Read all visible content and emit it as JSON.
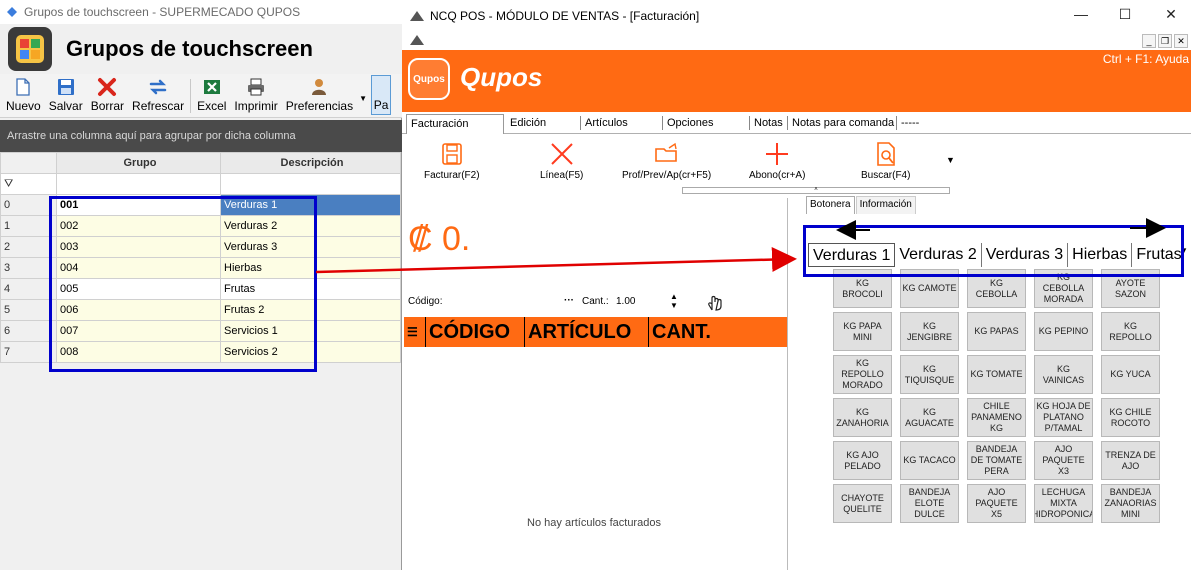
{
  "left_window": {
    "title": "Grupos de touchscreen - SUPERMECADO QUPOS",
    "header_title": "Grupos de touchscreen",
    "toolbar": [
      {
        "label": "Nuevo",
        "icon": "new-document-icon"
      },
      {
        "label": "Salvar",
        "icon": "save-icon"
      },
      {
        "label": "Borrar",
        "icon": "delete-x-icon"
      },
      {
        "label": "Refrescar",
        "icon": "refresh-icon"
      },
      {
        "label": "Excel",
        "icon": "excel-icon"
      },
      {
        "label": "Imprimir",
        "icon": "printer-icon"
      },
      {
        "label": "Preferencias",
        "icon": "user-preferences-icon"
      }
    ],
    "toolbar_cut_label": "Pa",
    "group_bar_text": "Arrastre una columna aquí para agrupar por dicha columna",
    "columns": [
      "Grupo",
      "Descripción"
    ],
    "rows": [
      {
        "index": "0",
        "grupo": "001",
        "descripcion": "Verduras 1"
      },
      {
        "index": "1",
        "grupo": "002",
        "descripcion": "Verduras 2"
      },
      {
        "index": "2",
        "grupo": "003",
        "descripcion": "Verduras 3"
      },
      {
        "index": "3",
        "grupo": "004",
        "descripcion": "Hierbas"
      },
      {
        "index": "4",
        "grupo": "005",
        "descripcion": "Frutas"
      },
      {
        "index": "5",
        "grupo": "006",
        "descripcion": "Frutas 2"
      },
      {
        "index": "6",
        "grupo": "007",
        "descripcion": "Servicios 1"
      },
      {
        "index": "7",
        "grupo": "008",
        "descripcion": "Servicios 2"
      }
    ]
  },
  "right_window": {
    "title": "NCQ POS - MÓDULO DE VENTAS - [Facturación]",
    "brand": "Qupos",
    "logo_text": "Qupos",
    "help_hint": "Ctrl + F1: Ayuda",
    "menu": [
      "Facturación",
      "Edición",
      "Artículos",
      "Opciones",
      "Notas",
      "Notas para comanda",
      "-----"
    ],
    "commands": [
      {
        "label": "Facturar(F2)",
        "icon": "save-icon"
      },
      {
        "label": "Línea(F5)",
        "icon": "delete-x-icon"
      },
      {
        "label": "Prof/Prev/Ap(cr+F5)",
        "icon": "folder-open-icon"
      },
      {
        "label": "Abono(cr+A)",
        "icon": "plus-icon"
      },
      {
        "label": "Buscar(F4)",
        "icon": "search-document-icon"
      }
    ],
    "total": "₡ 0.",
    "codigo_label": "Código:",
    "codigo_dots": "···",
    "cant_label": "Cant.:",
    "cant_value": "1.00",
    "items_columns": [
      "CÓDIGO",
      "ARTÍCULO",
      "CANT."
    ],
    "empty_message": "No hay artículos facturados",
    "side_tabs": [
      "Botonera",
      "Información"
    ],
    "category_tabs": [
      "Verduras 1",
      "Verduras 2",
      "Verduras 3",
      "Hierbas",
      "Frutas"
    ],
    "products": [
      "KG BROCOLI",
      "KG CAMOTE",
      "KG CEBOLLA",
      "KG CEBOLLA MORADA",
      "AYOTE SAZON",
      "KG PAPA MINI",
      "KG JENGIBRE",
      "KG PAPAS",
      "KG PEPINO",
      "KG REPOLLO",
      "KG REPOLLO MORADO",
      "KG TIQUISQUE",
      "KG TOMATE",
      "KG VAINICAS",
      "KG YUCA",
      "KG ZANAHORIA",
      "KG AGUACATE",
      "CHILE PANAMENO KG",
      "KG HOJA DE PLATANO P/TAMAL",
      "KG CHILE ROCOTO",
      "KG AJO PELADO",
      "KG TACACO",
      "BANDEJA DE TOMATE PERA",
      "AJO PAQUETE X3",
      "TRENZA DE AJO",
      "CHAYOTE QUELITE",
      "BANDEJA ELOTE DULCE",
      "AJO PAQUETE X5",
      "LECHUGA MIXTA HIDROPONICA",
      "BANDEJA ZANAORIAS MINI"
    ]
  },
  "colors": {
    "brand_orange": "#ff6a13",
    "highlight_blue": "#0000cc",
    "arrow_red": "#e00000",
    "selected_cell": "#4a7fc1"
  }
}
